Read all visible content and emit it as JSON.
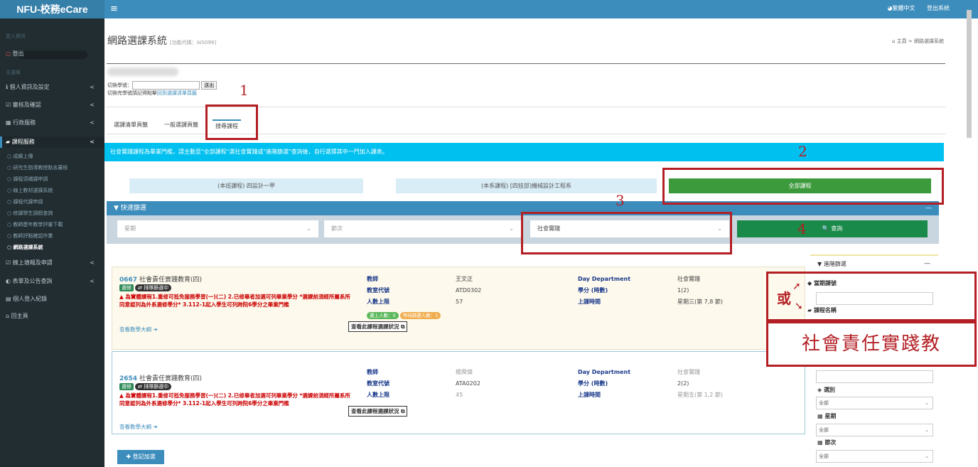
{
  "header": {
    "brand": "NFU-校務eCare",
    "menu_icon": "≡",
    "lang": "◕繁體中文",
    "logout": "登出系統"
  },
  "sidebar": {
    "user_header": "登入資訊",
    "logout_item": "登出",
    "main_header": "主選單",
    "items": [
      {
        "icon": "ℹ",
        "label": "個人資訊及設定",
        "arrow": "<"
      },
      {
        "icon": "☑",
        "label": "審核及確認",
        "arrow": "<"
      },
      {
        "icon": "▦",
        "label": "行政服務",
        "arrow": "<"
      },
      {
        "icon": "▰",
        "label": "課程服務",
        "arrow": "<"
      }
    ],
    "subitems": [
      "成績上傳",
      "研究生指導教授點名審核",
      "課程須補課申請",
      "線上教材選課系統",
      "課程代課申請",
      "修課學生請假查詢",
      "教師歷年教學評量下載",
      "教師評點確認作業",
      "網路選課系統"
    ],
    "items2": [
      {
        "icon": "☑",
        "label": "線上填報及申請",
        "arrow": "<"
      },
      {
        "icon": "◐",
        "label": "表單及公告查詢",
        "arrow": "<"
      },
      {
        "icon": "▤",
        "label": "個人登入紀錄",
        "arrow": ""
      },
      {
        "icon": "⌂",
        "label": "回主頁",
        "arrow": ""
      }
    ]
  },
  "page": {
    "title": "網路選課系統",
    "code": "[功能代碼：AIS099]",
    "breadcrumb": "⌂ 主頁 > 網路選課系統",
    "switch_label": "切換學號：",
    "switch_btn": "送出",
    "switch_hint": "切換完學號請記得點擊",
    "switch_link": "回到選課清單頁籤"
  },
  "tabs": [
    "選課清單頁籤",
    "一般選課頁籤",
    "搜尋課程"
  ],
  "alert": "社會實踐課程為畢業門檻，請主動至\"全部課程\"選社會實踐或\"進階篩選\"查詢後，自行選擇其中一門加入課表。",
  "course_buttons": [
    "(本班課程) 四設計一甲",
    "(本系課程) [四技部]機械設計工程系",
    "全部課程"
  ],
  "quick_filter": {
    "title": "▼ 快速篩選",
    "collapse": "—",
    "week_placeholder": "星期",
    "period_placeholder": "節次",
    "category": "社會實踐",
    "query": "🔍 查詢"
  },
  "courses": [
    {
      "code": "0667",
      "name": "社會責任實踐教育(四)",
      "tag": "選修",
      "tag2": "⇄ 排隊篩選中",
      "warning": "▲ 為實體課程1.重修可抵免服務學習(一)(二) 2.已修畢者加選可列畢業學分 *選課前須經所屬系所同意認列為外系選修學分* 3.112-1起入學生可列跨院6學分之畢業門檻",
      "link": "查看教學大綱 ➜",
      "teacher_label": "教師",
      "teacher": "王文正",
      "room_label": "教室代號",
      "room": "ATD0302",
      "limit_label": "人數上限",
      "limit": "57",
      "count1": "選上人數：0",
      "count2": "等待篩選人數：1",
      "check_btn": "查看此課程選課狀況 ⧉",
      "dept_label": "Day Department",
      "dept": "社會實踐",
      "credit_label": "學分 (時數)",
      "credit": "1(2)",
      "time_label": "上課時間",
      "time": "星期三(第 7,8 節)"
    },
    {
      "code": "2654",
      "name": "社會責任實踐教育(四)",
      "tag": "選修",
      "tag2": "⇄ 排隊篩選中",
      "warning": "▲ 為實體課程1.重修可抵免服務學習(一)(二) 2.已修畢者加選可列畢業學分 *選課前須經所屬系所同意認列為外系選修學分* 3.112-1起入學生可列跨院6學分之畢業門檻",
      "link": "查看教學大綱 ➜",
      "teacher_label": "教師",
      "teacher": "楊舜傑",
      "room_label": "教室代號",
      "room": "ATA0202",
      "limit_label": "人數上限",
      "limit": "45",
      "check_btn": "查看此課程選課狀況 ⧉",
      "dept_label": "Day Department",
      "dept": "社會實踐",
      "credit_label": "學分 (時數)",
      "credit": "2(2)",
      "time_label": "上課時間",
      "time": "星期五(第 1,2 節)"
    }
  ],
  "add_btn": "✚ 登記加選",
  "advanced": {
    "title": "▼ 進階篩選",
    "collapse": "—",
    "course_code": "◆ 當期課號",
    "course_name": "▰ 課程名稱",
    "group": "◈ 選別",
    "week": "▦ 星期",
    "period": "▦ 節次",
    "all": "全部",
    "next": "◈ 星期"
  },
  "annotations": {
    "n1": "1",
    "n2": "2",
    "n3": "3",
    "n4": "4",
    "or": "或",
    "keyword": "社會責任實踐教"
  }
}
